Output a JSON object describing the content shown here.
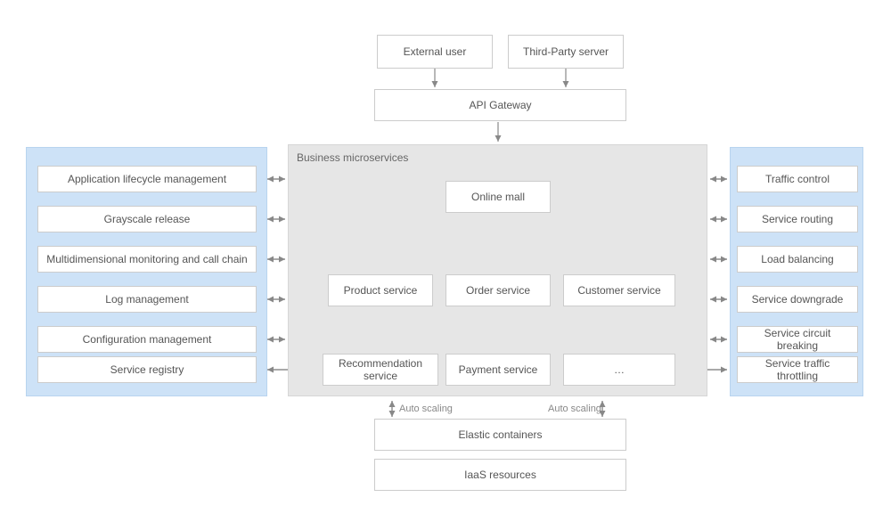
{
  "top": {
    "external_user": "External user",
    "third_party": "Third-Party server",
    "api_gateway": "API Gateway"
  },
  "left_panel": {
    "items": [
      "Application lifecycle management",
      "Grayscale release",
      "Multidimensional monitoring and call chain",
      "Log management",
      "Configuration management",
      "Service registry"
    ]
  },
  "center": {
    "title": "Business microservices",
    "online_mall": "Online mall",
    "row2": {
      "product": "Product service",
      "order": "Order service",
      "customer": "Customer service"
    },
    "row3": {
      "recommendation": "Recommendation service",
      "payment": "Payment service",
      "more": "…"
    }
  },
  "right_panel": {
    "items": [
      "Traffic control",
      "Service routing",
      "Load balancing",
      "Service downgrade",
      "Service circuit breaking",
      "Service traffic throttling"
    ]
  },
  "bottom": {
    "auto_scaling": "Auto scaling",
    "elastic": "Elastic containers",
    "iaas": "IaaS resources"
  }
}
